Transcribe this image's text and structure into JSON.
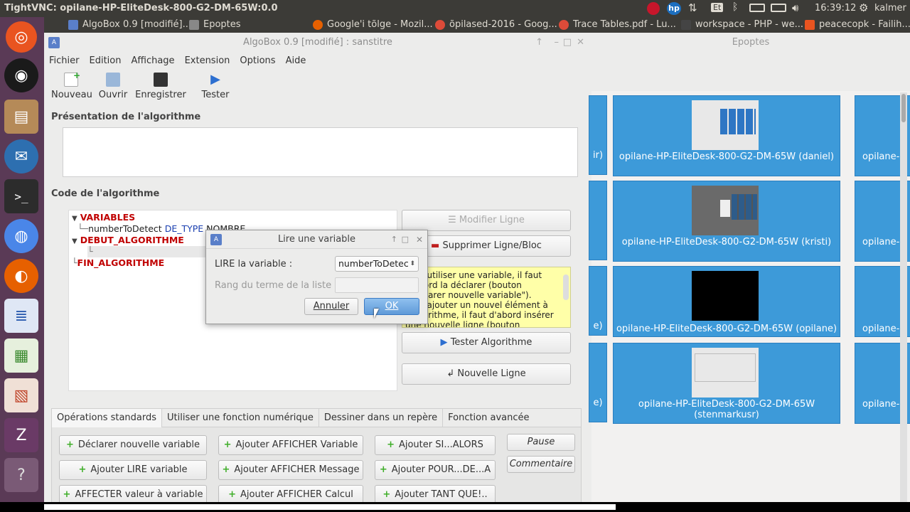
{
  "vnc_title": "TightVNC: opilane-HP-EliteDesk-800-G2-DM-65W:0.0",
  "top_panel": {
    "tasks": [
      "AlgoBox 0.9 [modifié]...",
      "Epoptes",
      "Google'i tõlge - Mozil...",
      "õpilased-2016 - Goog...",
      "Trace Tables.pdf - Lu...",
      "workspace - PHP - we...",
      "peacecopk - Failih..."
    ],
    "keyboard": "Et",
    "time": "16:39:12",
    "user": "kalmer"
  },
  "algobox": {
    "title": "AlgoBox 0.9 [modifié] : sanstitre",
    "menus": [
      "Fichier",
      "Edition",
      "Affichage",
      "Extension",
      "Options",
      "Aide"
    ],
    "toolbar": [
      "Nouveau",
      "Ouvrir",
      "Enregistrer",
      "Tester"
    ],
    "presentation_title": "Présentation de l'algorithme",
    "code_title": "Code de l'algorithme",
    "tree": {
      "variables": "VARIABLES",
      "var1_name": "numberToDetect",
      "var1_type": "DE_TYPE",
      "var1_kind": "NOMBRE",
      "debut": "DEBUT_ALGORITHME",
      "fin": "FIN_ALGORITHME"
    },
    "right_buttons": {
      "modifier": "Modifier Ligne",
      "supprimer": "Supprimer Ligne/Bloc",
      "tester": "Tester Algorithme",
      "nouvelle": "Nouvelle Ligne"
    },
    "help_lines": [
      "Pour utiliser une variable, il faut",
      "d'abord la déclarer (bouton",
      "\"Déclarer nouvelle variable\").",
      "Pour ajouter un nouvel élément à",
      "l'algorithme, il faut d'abord insérer",
      "une nouvelle ligne (bouton"
    ],
    "tabs": [
      "Opérations standards",
      "Utiliser une fonction numérique",
      "Dessiner dans un repère",
      "Fonction avancée"
    ],
    "ops": {
      "declarer": "Déclarer nouvelle variable",
      "lire": "Ajouter LIRE variable",
      "affecter": "AFFECTER valeur à variable",
      "afficher_var": "Ajouter AFFICHER Variable",
      "afficher_msg": "Ajouter AFFICHER Message",
      "afficher_calc": "Ajouter AFFICHER Calcul",
      "si": "Ajouter SI...ALORS",
      "pour": "Ajouter POUR...DE...A",
      "tant": "Ajouter TANT QUE!..",
      "pause": "Pause",
      "commentaire": "Commentaire"
    }
  },
  "dialog": {
    "title": "Lire une variable",
    "lire_label": "LIRE la variable :",
    "lire_value": "numberToDetec",
    "rang_label": "Rang du terme de la liste :",
    "cancel": "Annuler",
    "ok": "OK"
  },
  "epoptes": {
    "title": "Epoptes",
    "left_cut": [
      "ir)",
      "",
      "e)",
      "e)"
    ],
    "right_cut": [
      "opilane-H",
      "opilane-H",
      "opilane-H",
      "opilane-H"
    ],
    "clients": [
      {
        "line1": "opilane-HP-EliteDesk-800-G2-DM-65W (daniel)",
        "line2": ""
      },
      {
        "line1": "opilane-HP-EliteDesk-800-G2-DM-65W (kristi)",
        "line2": ""
      },
      {
        "line1": "opilane-HP-EliteDesk-800-G2-DM-65W (opilane)",
        "line2": ""
      },
      {
        "line1": "opilane-HP-EliteDesk-800-G2-DM-65W",
        "line2": "(stenmarkusr)"
      }
    ]
  },
  "colors": {
    "launcher": "#5a3a56",
    "accent_orange": "#e95420",
    "tile_blue": "#3d9ad9",
    "help_yellow": "#ffffa8",
    "keyword_red": "#c00000",
    "type_blue": "#1a3fb0"
  }
}
